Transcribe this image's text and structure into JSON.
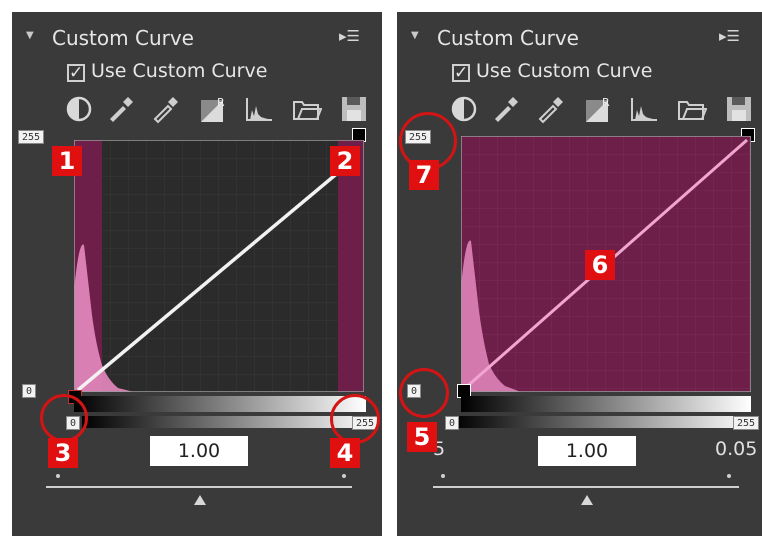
{
  "left_panel": {
    "title": "Custom Curve",
    "checkbox_label": "Use Custom Curve",
    "checkbox_mark": "✓",
    "input_max": "255",
    "input_min": "0",
    "output_min": "0",
    "output_max": "255",
    "gamma": "1.00",
    "callouts": [
      "1",
      "2",
      "3",
      "4"
    ]
  },
  "right_panel": {
    "title": "Custom Curve",
    "checkbox_label": "Use Custom Curve",
    "checkbox_mark": "✓",
    "input_max": "255",
    "input_min": "0",
    "output_min": "0",
    "output_max": "255",
    "gamma": "1.00",
    "side_left": "5",
    "side_right": "0.05",
    "callouts": [
      "5",
      "6",
      "7"
    ]
  },
  "toolbar_icons": [
    "contrast-icon",
    "black-eyedropper-icon",
    "white-eyedropper-icon",
    "reset-icon",
    "histogram-icon",
    "open-folder-icon",
    "save-icon"
  ],
  "colors": {
    "panel": "#3a3a3a",
    "plot_bg": "#2b2b2b",
    "clip_magenta": "#6d1f4a",
    "histogram": "#e58ac0",
    "curve_left": "#f2f2f2",
    "curve_right": "#f0a6cf",
    "callout_red": "#e01010"
  }
}
